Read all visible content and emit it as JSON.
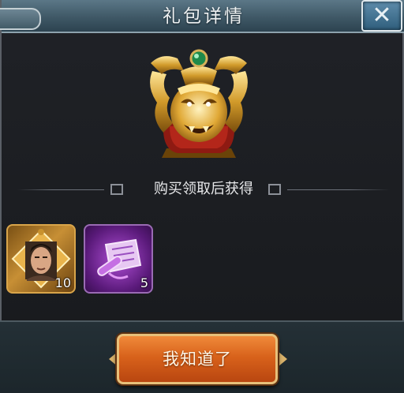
{
  "dialog": {
    "title": "礼包详情",
    "close_icon": "close-x-icon",
    "reward_caption": "购买领取后获得",
    "chest_icon": "golden-dragon-chest-icon"
  },
  "items": [
    {
      "icon": "hero-portrait-fragment-icon",
      "count": "10",
      "rarity_color": "#c78f35"
    },
    {
      "icon": "purple-scroll-icon",
      "count": "5",
      "rarity_color": "#b04fd6"
    }
  ],
  "footer": {
    "confirm_label": "我知道了"
  },
  "colors": {
    "header": "#3f5866",
    "button": "#d8621b",
    "background": "#1b1d21"
  }
}
